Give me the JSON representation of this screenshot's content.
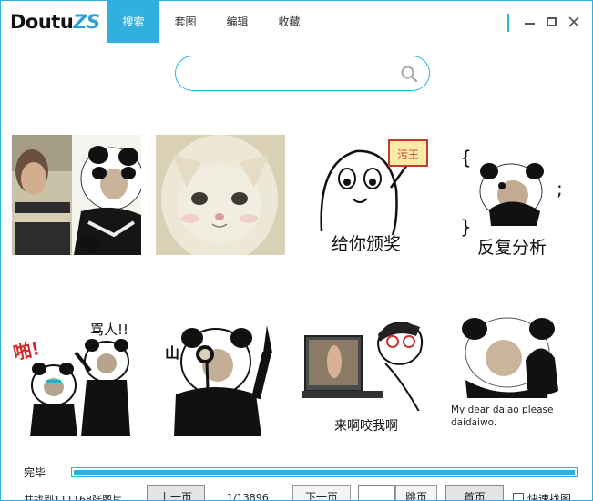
{
  "app": {
    "logo": "Doutu",
    "logo_accent": "ZS"
  },
  "tabs": [
    {
      "label": "搜索",
      "active": true
    },
    {
      "label": "套图",
      "active": false
    },
    {
      "label": "编辑",
      "active": false
    },
    {
      "label": "收藏",
      "active": false
    }
  ],
  "search": {
    "value": "",
    "placeholder": ""
  },
  "images": [
    {
      "caption": ""
    },
    {
      "caption": ""
    },
    {
      "caption": "给你颁奖",
      "badge": "污王"
    },
    {
      "caption": "反复分析"
    },
    {
      "caption": "骂人!!",
      "side": "啪!"
    },
    {
      "caption": "",
      "side": "山"
    },
    {
      "caption": "来啊咬我啊"
    },
    {
      "caption": "My dear dalao please daidaiwo."
    }
  ],
  "status": {
    "text": "完毕",
    "progress": 1.0
  },
  "footer": {
    "found_text": "共找到111168张图片",
    "prev_label": "上一页",
    "page_info": "1/13896",
    "next_label": "下一页",
    "page_input_value": "",
    "jump_label": "跳页",
    "home_label": "首页",
    "quick_search_label": "快速找图",
    "quick_search_checked": false
  },
  "colors": {
    "accent": "#2fb0de"
  }
}
